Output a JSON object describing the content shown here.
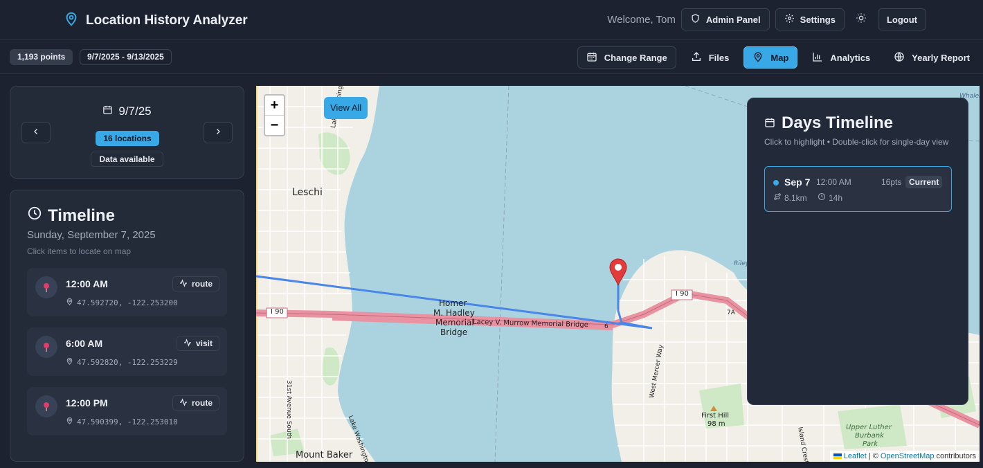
{
  "header": {
    "title": "Location History Analyzer",
    "welcome": "Welcome, Tom",
    "admin_label": "Admin Panel",
    "settings_label": "Settings",
    "logout_label": "Logout"
  },
  "toolbar": {
    "points_badge": "1,193 points",
    "date_range": "9/7/2025 - 9/13/2025",
    "nav": [
      {
        "label": "Change Range",
        "icon": "calendar-icon"
      },
      {
        "label": "Files",
        "icon": "upload-icon"
      },
      {
        "label": "Map",
        "icon": "map-pin-icon",
        "active": true
      },
      {
        "label": "Analytics",
        "icon": "bar-chart-icon"
      },
      {
        "label": "Yearly Report",
        "icon": "globe-icon"
      }
    ]
  },
  "date_card": {
    "date": "9/7/25",
    "locations_badge": "16 locations",
    "status_badge": "Data available"
  },
  "timeline": {
    "title": "Timeline",
    "subtitle": "Sunday, September 7, 2025",
    "hint": "Click items to locate on map",
    "items": [
      {
        "time": "12:00 AM",
        "coords": "47.592720, -122.253200",
        "tag": "route"
      },
      {
        "time": "6:00 AM",
        "coords": "47.592820, -122.253229",
        "tag": "visit"
      },
      {
        "time": "12:00 PM",
        "coords": "47.590399, -122.253010",
        "tag": "route"
      }
    ]
  },
  "map": {
    "view_all_label": "View All",
    "zoom_in": "+",
    "zoom_out": "−",
    "labels": {
      "leschi": "Leschi",
      "bridge_1": "Homer",
      "bridge_2": "M. Hadley",
      "bridge_3": "Memorial",
      "bridge_4": "Bridge",
      "lacey": "Lacey V. Murrow Memorial Bridge",
      "i90_w": "I 90",
      "i90_e": "I 90",
      "lake_wa_blvd": "Lake Washington Boulevard",
      "lake_wa_blvd_s": "Lake Washington",
      "ave31": "31st Avenue South",
      "mount_baker": "Mount Baker",
      "west_mercer": "West Mercer Way",
      "first_hill": "First Hill",
      "first_hill_elev": "98 m",
      "upper_luther": "Upper Luther",
      "burbank": "Burbank",
      "park": "Park",
      "island_crest": "Island Crest",
      "riley": "Riley",
      "whaler": "Whaler",
      "route_7a": "7A",
      "route_6": "6"
    },
    "attribution": {
      "leaflet": "Leaflet",
      "sep": "| ©",
      "osm": "OpenStreetMap",
      "contrib": "contributors"
    }
  },
  "days_panel": {
    "title": "Days Timeline",
    "hint": "Click to highlight • Double-click for single-day view",
    "days": [
      {
        "label": "Sep 7",
        "time": "12:00 AM",
        "points": "16pts",
        "status": "Current",
        "distance": "8.1km",
        "duration": "14h"
      }
    ]
  },
  "colors": {
    "accent": "#38a8e6",
    "background": "#1c2230",
    "card": "#232a38",
    "route": "#4a86e8",
    "marker": "#e23b3b"
  }
}
